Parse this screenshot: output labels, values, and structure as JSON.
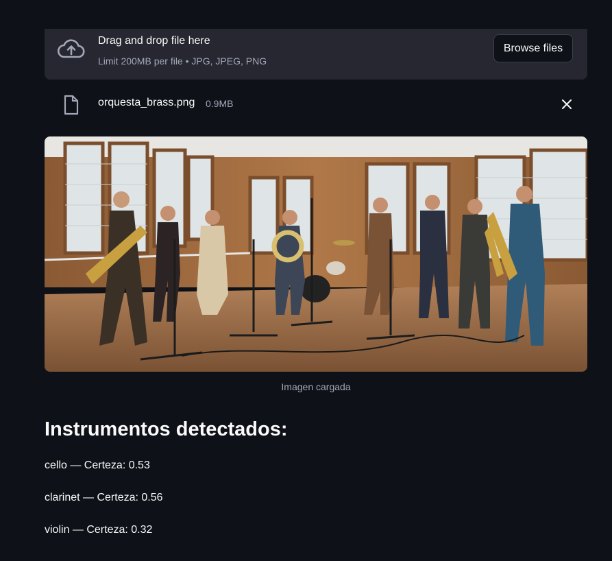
{
  "uploader": {
    "title": "Drag and drop file here",
    "limits": "Limit 200MB per file • JPG, JPEG, PNG",
    "browse_label": "Browse files",
    "icon": "cloud-upload-icon"
  },
  "file": {
    "name": "orquesta_brass.png",
    "size": "0.9MB",
    "icon": "file-icon",
    "remove_icon": "close-icon"
  },
  "image": {
    "caption": "Imagen cargada"
  },
  "results": {
    "heading": "Instrumentos detectados:",
    "items": [
      {
        "text": "cello — Certeza: 0.53"
      },
      {
        "text": "clarinet — Certeza: 0.56"
      },
      {
        "text": "violin — Certeza: 0.32"
      }
    ]
  },
  "colors": {
    "background": "#0e1117",
    "panel": "#262730",
    "text": "#fafafa",
    "muted": "#a3a8b8"
  }
}
